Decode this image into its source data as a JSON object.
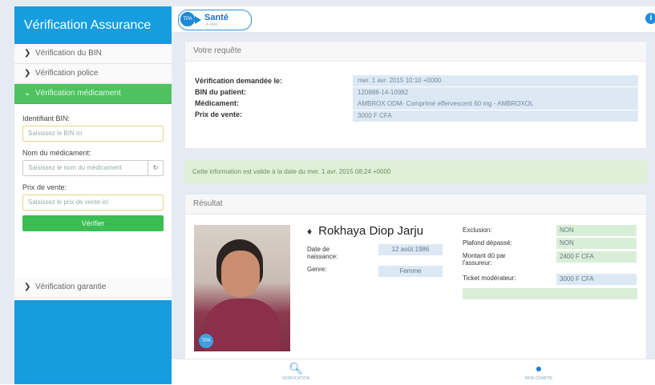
{
  "sidebar": {
    "title": "Vérification Assurance",
    "items": [
      {
        "label": "Vérification du BIN"
      },
      {
        "label": "Vérification police"
      },
      {
        "label": "Vérification médicament"
      },
      {
        "label": "Vérification garantie"
      }
    ],
    "form": {
      "bin_label": "Identifiant BIN:",
      "bin_placeholder": "Saisissez le BIN ici",
      "med_label": "Nom du médicament:",
      "med_placeholder": "Saisissez le nom du médicament",
      "price_label": "Prix de vente:",
      "price_placeholder": "Saisissez le prix de vente ici",
      "verify_label": "Vérifier"
    }
  },
  "header": {
    "logo_text": "Santé",
    "logo_sub": "e-care",
    "logo_badge": "TPA"
  },
  "request": {
    "title": "Votre requête",
    "rows": [
      {
        "label": "Vérification demandée le:",
        "value": "mer. 1 avr. 2015 10:10 +0000"
      },
      {
        "label": "BIN du patient:",
        "value": "120888-14-10982"
      },
      {
        "label": "Médicament:",
        "value": "AMBROX ODM- Comprimé effervescent 60 mg - AMBROXOL"
      },
      {
        "label": "Prix de vente:",
        "value": "3000 F CFA"
      }
    ]
  },
  "notice": "Cette information est valide à la date du mer. 1 avr. 2015 08:24 +0000",
  "result": {
    "title": "Résultat",
    "patient_name": "Rokhaya Diop Jarju",
    "dob_label": "Date de naissance:",
    "dob_value": "12 août 1986",
    "gender_label": "Genre:",
    "gender_value": "Femme",
    "exclusion_label": "Exclusion:",
    "exclusion_value": "NON",
    "ceiling_label": "Plafond dépassé:",
    "ceiling_value": "NON",
    "amount_label": "Montant dû par l'assureur:",
    "amount_value": "2400 F CFA",
    "ticket_label": "Ticket modérateur:",
    "ticket_value": "3000 F CFA"
  },
  "tabs": [
    {
      "label": "VÉRIFICATION",
      "icon": "search-icon"
    },
    {
      "label": "MON COMPTE",
      "icon": "user-icon"
    }
  ]
}
